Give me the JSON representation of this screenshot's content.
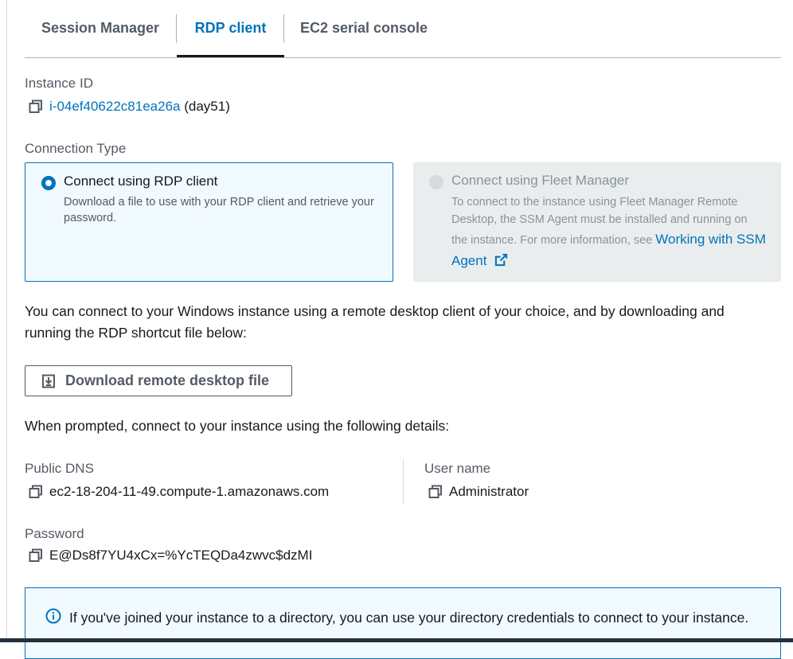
{
  "tabs": [
    {
      "label": "Session Manager",
      "active": false
    },
    {
      "label": "RDP client",
      "active": true
    },
    {
      "label": "EC2 serial console",
      "active": false
    }
  ],
  "instance": {
    "label": "Instance ID",
    "id": "i-04ef40622c81ea26a",
    "name": "(day51)"
  },
  "connection_type": {
    "label": "Connection Type",
    "options": [
      {
        "title": "Connect using RDP client",
        "description": "Download a file to use with your RDP client and retrieve your password.",
        "selected": true,
        "disabled": false
      },
      {
        "title": "Connect using Fleet Manager",
        "description": "To connect to the instance using Fleet Manager Remote Desktop, the SSM Agent must be installed and running on the instance. For more information, see",
        "link_text": "Working with SSM Agent",
        "selected": false,
        "disabled": true
      }
    ]
  },
  "intro_text": "You can connect to your Windows instance using a remote desktop client of your choice, and by downloading and running the RDP shortcut file below:",
  "download_button": {
    "label": "Download remote desktop file",
    "icon": "download-icon"
  },
  "prompt_text": "When prompted, connect to your instance using the following details:",
  "details": {
    "public_dns": {
      "label": "Public DNS",
      "value": "ec2-18-204-11-49.compute-1.amazonaws.com"
    },
    "user_name": {
      "label": "User name",
      "value": "Administrator"
    },
    "password": {
      "label": "Password",
      "value": "E@Ds8f7YU4xCx=%YcTEQDa4zwvc$dzMI"
    }
  },
  "info_alert": {
    "icon": "info-icon",
    "text": "If you've joined your instance to a directory, you can use your directory credentials to connect to your instance."
  },
  "colors": {
    "accent": "#0073bb",
    "text": "#16191f",
    "muted": "#545b64",
    "disabled_bg": "#eaeded",
    "selected_bg": "#f1faff"
  }
}
